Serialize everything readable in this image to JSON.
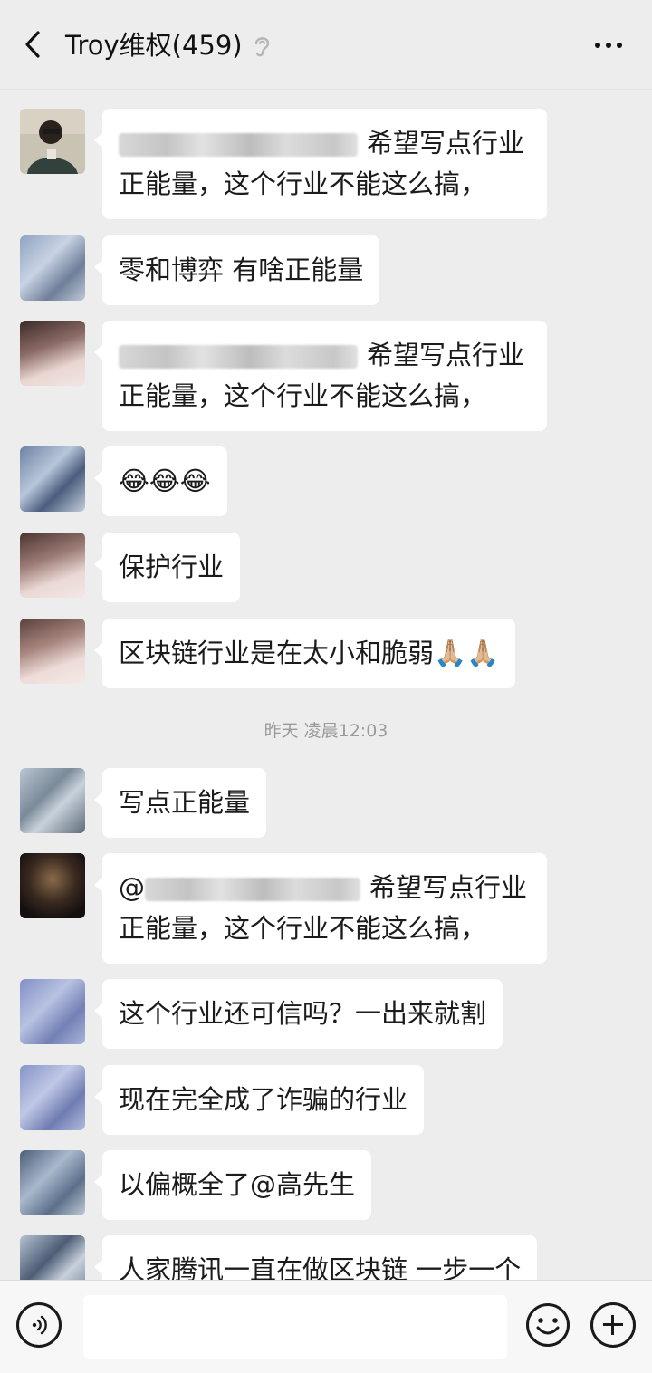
{
  "header": {
    "title": "Troy维权(459)",
    "back_icon": "chevron-left-icon",
    "mute_icon": "ear-icon",
    "more_icon": "more-dots-icon"
  },
  "messages": [
    {
      "lines": [
        "希望写点行业",
        "正能量，这个行业不能这么搞，"
      ],
      "redacted_prefix": true
    },
    {
      "lines": [
        "零和博弈 有啥正能量"
      ]
    },
    {
      "lines": [
        "希望写点行业",
        "正能量，这个行业不能这么搞，"
      ],
      "redacted_prefix": true
    },
    {
      "lines": [
        "😂😂😂"
      ]
    },
    {
      "lines": [
        "保护行业"
      ]
    },
    {
      "lines": [
        "区块链行业是在太小和脆弱🙏🏼🙏🏼"
      ]
    },
    {
      "lines": [
        "写点正能量"
      ]
    },
    {
      "lines": [
        "@",
        "希望写点行业",
        "正能量，这个行业不能这么搞，"
      ],
      "redacted_prefix": true
    },
    {
      "lines": [
        "这个行业还可信吗？一出来就割"
      ]
    },
    {
      "lines": [
        "现在完全成了诈骗的行业"
      ]
    },
    {
      "lines": [
        "以偏概全了@高先生"
      ]
    },
    {
      "lines": [
        "人家腾讯一直在做区块链 一步一个"
      ]
    }
  ],
  "timestamp": "昨天 凌晨12:03",
  "footer": {
    "voice_icon": "voice-icon",
    "emoji_icon": "smiley-icon",
    "plus_icon": "plus-circle-icon",
    "input_value": ""
  },
  "colors": {
    "background": "#ededed",
    "bubble": "#ffffff",
    "text": "#191919",
    "timestamp": "#9a9a9a"
  }
}
